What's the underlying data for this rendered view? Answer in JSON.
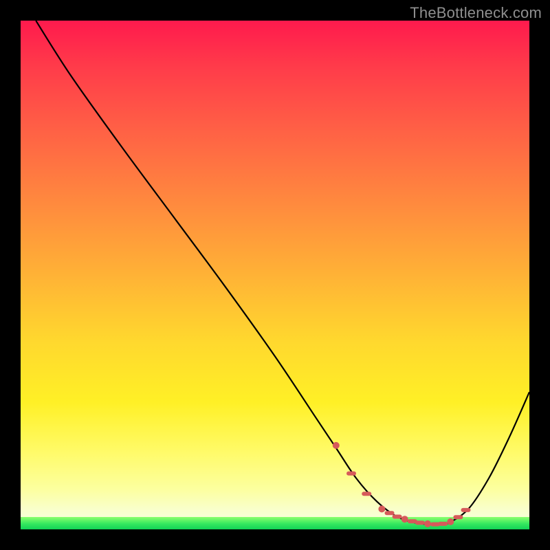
{
  "watermark": "TheBottleneck.com",
  "colors": {
    "background_frame": "#000000",
    "gradient_top": "#ff1a4d",
    "gradient_mid": "#ffd82e",
    "gradient_bottom": "#f6ffe8",
    "green_strip_top": "#8bff6e",
    "green_strip_bottom": "#12d257",
    "curve": "#000000",
    "markers": "#d65a5a",
    "watermark_text": "#8f8f8f"
  },
  "chart_data": {
    "type": "line",
    "title": "",
    "xlabel": "",
    "ylabel": "",
    "xlim": [
      0,
      100
    ],
    "ylim": [
      0,
      100
    ],
    "grid": false,
    "legend": null,
    "series": [
      {
        "name": "bottleneck-curve",
        "x": [
          3,
          10,
          20,
          30,
          40,
          50,
          58,
          62,
          66,
          70,
          74,
          78,
          82,
          84,
          88,
          92,
          96,
          100
        ],
        "values": [
          100,
          89,
          75,
          61.5,
          48,
          34,
          22,
          16,
          10,
          5.5,
          2.5,
          1.2,
          1.0,
          1.2,
          4,
          10,
          18,
          27
        ]
      }
    ],
    "annotations": {
      "valley_markers_x": [
        62,
        65,
        68,
        71,
        72.5,
        74,
        75.5,
        77,
        78.5,
        80,
        81.5,
        83,
        84.5,
        86,
        87.5
      ],
      "valley_markers_y": [
        16.5,
        11,
        7,
        4,
        3.2,
        2.5,
        2,
        1.6,
        1.3,
        1.1,
        1.0,
        1.1,
        1.5,
        2.4,
        3.8
      ]
    }
  }
}
